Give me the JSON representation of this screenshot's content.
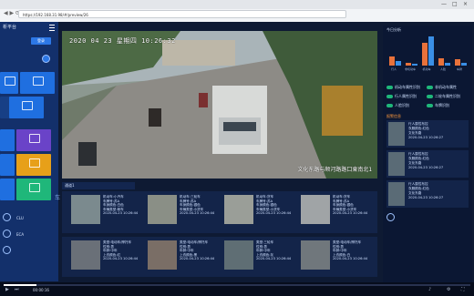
{
  "browser": {
    "address": "https://192.168.31.98/#/preview/26",
    "window_controls": [
      "—",
      "□",
      "×"
    ],
    "nav": "◀ ▶ ⟳"
  },
  "sidebar": {
    "brand": "析平台",
    "login_label": "登录",
    "tiles": [
      {
        "label": "",
        "color": "#1f6fe0"
      },
      {
        "label": "",
        "color": "#1f6fe0"
      },
      {
        "label": "",
        "color": "#1f6fe0"
      },
      {
        "label": "",
        "color": "#6a43c8"
      },
      {
        "label": "",
        "color": "#e7a019"
      },
      {
        "label": "",
        "color": "#1f6fe0"
      },
      {
        "label": "",
        "color": "#1fb77a"
      }
    ],
    "bottom_labels": [
      "CLU",
      "ECA"
    ]
  },
  "video": {
    "timestamp": "2020 04 23 星期四 10:26:32",
    "caption": "文化东路与顺河路路口東南北1"
  },
  "right_panel": {
    "title": "今日分析",
    "chart_data": {
      "type": "bar",
      "categories": [
        "行人",
        "非机动车",
        "机动车",
        "人脸",
        "车牌"
      ],
      "series": [
        {
          "name": "",
          "values": [
            12,
            4,
            30,
            10,
            8
          ],
          "color": "#e9723b"
        },
        {
          "name": "",
          "values": [
            6,
            2,
            38,
            3,
            4
          ],
          "color": "#3a8fe6"
        }
      ],
      "ylim": [
        0,
        40
      ]
    },
    "controls": [
      "机动车属性识别",
      "行人属性识别",
      "人脸识别"
    ],
    "controls2": [
      "非机动车属性",
      "二轮车属性识别",
      "车牌识别"
    ],
    "alarm_title": "报警信息",
    "alarms": [
      {
        "line1": "行人属性布控",
        "line2": "衣服颜色:红色",
        "line3": "文化东路",
        "line4": "2020-04-23 10:26:27"
      },
      {
        "line1": "行人属性布控",
        "line2": "衣服颜色:红色",
        "line3": "文化东路",
        "line4": "2020-04-23 10:26:27"
      },
      {
        "line1": "行人属性布控",
        "line2": "衣服颜色:红色",
        "line3": "文化东路",
        "line4": "2020-04-23 10:26:27"
      }
    ]
  },
  "bottom": {
    "camera_select": "通道1",
    "vehicles": [
      {
        "t1": "机动车:小汽车",
        "t2": "车牌号:苏A",
        "t3": "车身颜色:白色",
        "t4": "车辆类型:轿车",
        "t5": "2020-04-23 10:26:44"
      },
      {
        "t1": "机动车:三轮车",
        "t2": "车牌号:苏A",
        "t3": "车身颜色:银色",
        "t4": "车辆类型:小货车",
        "t5": "2020-04-23 10:26:44"
      },
      {
        "t1": "机动车:货车",
        "t2": "车牌号:苏A",
        "t3": "车身颜色:银色",
        "t4": "车辆类型:小货车",
        "t5": "2020-04-23 10:26:44"
      },
      {
        "t1": "机动车:货车",
        "t2": "车牌号:苏A",
        "t3": "车身颜色:银色",
        "t4": "车辆类型:小货车",
        "t5": "2020-04-23 10:26:44"
      }
    ],
    "persons": [
      {
        "t1": "类型:电动车/摩托车",
        "t2": "性别:男",
        "t3": "年龄:中年",
        "t4": "上衣颜色:红",
        "t5": "2020-04-23 10:26:44"
      },
      {
        "t1": "类型:电动车/摩托车",
        "t2": "性别:男",
        "t3": "年龄:中年",
        "t4": "上衣颜色:黑",
        "t5": "2020-04-23 10:26:44"
      },
      {
        "t1": "类型:三轮车",
        "t2": "性别:男",
        "t3": "年龄:中年",
        "t4": "上衣颜色:灰",
        "t5": "2020-04-23 10:26:44"
      },
      {
        "t1": "类型:电动车/摩托车",
        "t2": "性别:男",
        "t3": "年龄:中年",
        "t4": "上衣颜色:白",
        "t5": "2020-04-23 10:26:44"
      }
    ],
    "section_glyph": "车"
  },
  "player": {
    "time": "00:00:16",
    "progress": 0.07
  }
}
